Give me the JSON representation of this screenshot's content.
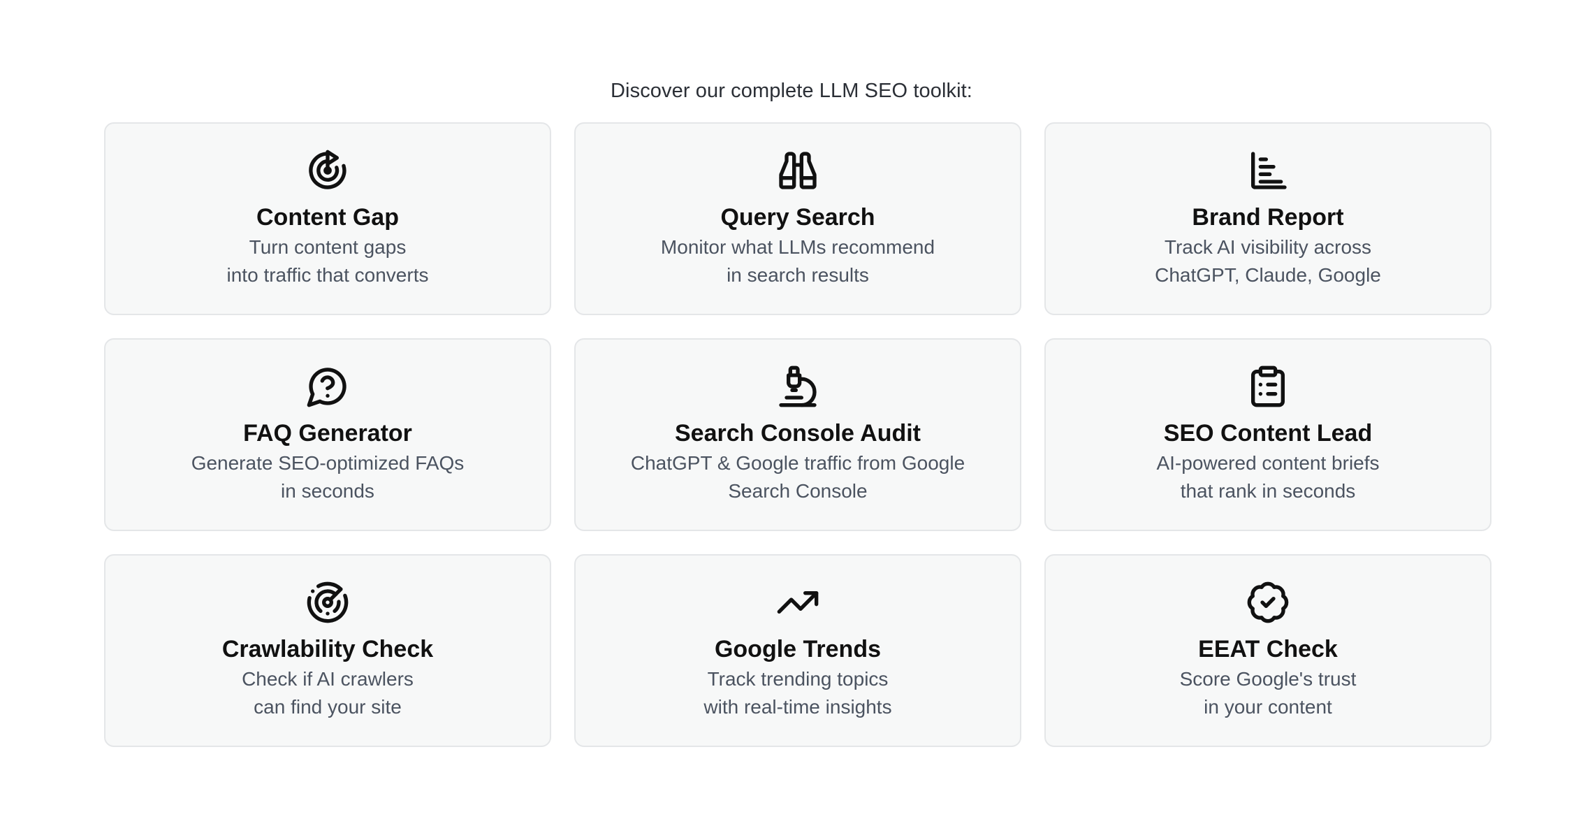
{
  "heading": "Discover our complete LLM SEO toolkit:",
  "cards": [
    {
      "icon": "target-arrow-icon",
      "title": "Content Gap",
      "line1": "Turn content gaps",
      "line2": "into traffic that converts"
    },
    {
      "icon": "binoculars-icon",
      "title": "Query Search",
      "line1": "Monitor what LLMs recommend",
      "line2": "in search results"
    },
    {
      "icon": "bar-chart-icon",
      "title": "Brand Report",
      "line1": "Track AI visibility across",
      "line2": "ChatGPT, Claude, Google"
    },
    {
      "icon": "question-bubble-icon",
      "title": "FAQ Generator",
      "line1": "Generate SEO-optimized FAQs",
      "line2": "in seconds"
    },
    {
      "icon": "microscope-icon",
      "title": "Search Console Audit",
      "line1": "ChatGPT & Google traffic from Google",
      "line2": "Search Console"
    },
    {
      "icon": "clipboard-list-icon",
      "title": "SEO Content Lead",
      "line1": "AI-powered content briefs",
      "line2": "that rank in seconds"
    },
    {
      "icon": "radar-icon",
      "title": "Crawlability Check",
      "line1": "Check if AI crawlers",
      "line2": "can find your site"
    },
    {
      "icon": "trending-up-icon",
      "title": "Google Trends",
      "line1": "Track trending topics",
      "line2": "with real-time insights"
    },
    {
      "icon": "badge-check-icon",
      "title": "EEAT Check",
      "line1": "Score Google's trust",
      "line2": "in your content"
    }
  ]
}
